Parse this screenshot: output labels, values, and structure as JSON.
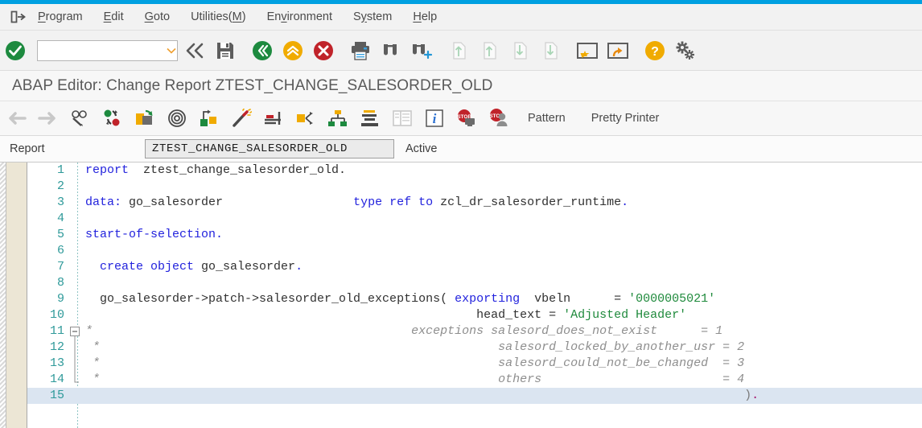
{
  "window": {
    "accent_color": "#00a0e1",
    "page_title": "ABAP Editor: Change Report ZTEST_CHANGE_SALESORDER_OLD"
  },
  "menubar": {
    "exit_icon": "exit-arrow-icon",
    "items": [
      {
        "label": "Program",
        "accel": "P"
      },
      {
        "label": "Edit",
        "accel": "E"
      },
      {
        "label": "Goto",
        "accel": "G"
      },
      {
        "label": "Utilities(M)",
        "accel": "M"
      },
      {
        "label": "Environment",
        "accel": "v"
      },
      {
        "label": "System",
        "accel": "y"
      },
      {
        "label": "Help",
        "accel": "H"
      }
    ]
  },
  "toolbar": {
    "enter_icon": "green-check-enter-icon",
    "command_field": {
      "value": "",
      "placeholder": ""
    },
    "dropdown_icon": "chevron-down-icon",
    "items": [
      {
        "name": "back-double-chevron-icon",
        "enabled": true
      },
      {
        "name": "save-icon",
        "enabled": true
      },
      {
        "name": "back-green-icon",
        "enabled": true
      },
      {
        "name": "exit-yellow-icon",
        "enabled": true
      },
      {
        "name": "cancel-red-icon",
        "enabled": true
      },
      {
        "name": "print-icon",
        "enabled": true
      },
      {
        "name": "find-icon",
        "enabled": true
      },
      {
        "name": "find-next-icon",
        "enabled": true
      },
      {
        "name": "first-page-icon",
        "enabled": false
      },
      {
        "name": "previous-page-icon",
        "enabled": false
      },
      {
        "name": "next-page-icon",
        "enabled": false
      },
      {
        "name": "last-page-icon",
        "enabled": false
      },
      {
        "name": "create-session-icon",
        "enabled": true
      },
      {
        "name": "create-shortcut-icon",
        "enabled": true
      },
      {
        "name": "help-icon",
        "enabled": true
      },
      {
        "name": "customize-layout-icon",
        "enabled": true
      }
    ]
  },
  "toolbar2": {
    "items": [
      {
        "name": "back-arrow-icon",
        "enabled": false
      },
      {
        "name": "forward-arrow-icon",
        "enabled": false
      },
      {
        "name": "display-change-icon",
        "enabled": true
      },
      {
        "name": "check-activate-icon",
        "enabled": true
      },
      {
        "name": "activate-icon",
        "enabled": true
      },
      {
        "name": "where-used-icon",
        "enabled": true
      },
      {
        "name": "insert-statement-icon",
        "enabled": true
      },
      {
        "name": "pretty-format-icon",
        "enabled": true
      },
      {
        "name": "signature-icon",
        "enabled": true
      },
      {
        "name": "navigate-icon",
        "enabled": true
      },
      {
        "name": "object-list-icon",
        "enabled": true
      },
      {
        "name": "outline-icon",
        "enabled": true
      },
      {
        "name": "split-screen-icon",
        "enabled": false
      },
      {
        "name": "info-icon",
        "enabled": true
      },
      {
        "name": "breakpoint-icon",
        "enabled": true
      },
      {
        "name": "user-breakpoint-icon",
        "enabled": true
      }
    ],
    "pattern_label": "Pattern",
    "pretty_printer_label": "Pretty Printer"
  },
  "report_bar": {
    "label": "Report",
    "name_value": "ZTEST_CHANGE_SALESORDER_OLD",
    "status": "Active"
  },
  "editor": {
    "selected_line": 15,
    "fold_start_line": 11,
    "fold_end_line": 14,
    "fold_icon": "collapse-minus-icon",
    "lines": [
      {
        "no": "1",
        "segments": [
          {
            "text": "report",
            "type": "keyword"
          },
          {
            "text": "  ztest_change_salesorder_old.",
            "type": "identifier"
          }
        ]
      },
      {
        "no": "2",
        "segments": []
      },
      {
        "no": "3",
        "segments": [
          {
            "text": "data:",
            "type": "keyword"
          },
          {
            "text": " go_salesorder",
            "type": "identifier"
          },
          {
            "text": "                  ",
            "type": "identifier"
          },
          {
            "text": "type ref to",
            "type": "keyword"
          },
          {
            "text": " zcl_dr_salesorder_runtime",
            "type": "identifier"
          },
          {
            "text": ".",
            "type": "keyword"
          }
        ]
      },
      {
        "no": "4",
        "segments": []
      },
      {
        "no": "5",
        "segments": [
          {
            "text": "start-of-selection",
            "type": "keyword"
          },
          {
            "text": ".",
            "type": "keyword"
          }
        ]
      },
      {
        "no": "6",
        "segments": []
      },
      {
        "no": "7",
        "segments": [
          {
            "text": "  create object",
            "type": "keyword"
          },
          {
            "text": " go_salesorder",
            "type": "identifier"
          },
          {
            "text": ".",
            "type": "keyword"
          }
        ]
      },
      {
        "no": "8",
        "segments": []
      },
      {
        "no": "9",
        "segments": [
          {
            "text": "  go_salesorder->patch->salesorder_old_exceptions(",
            "type": "identifier"
          },
          {
            "text": " exporting",
            "type": "keyword"
          },
          {
            "text": "  vbeln      = ",
            "type": "identifier"
          },
          {
            "text": "'0000005021'",
            "type": "string"
          }
        ]
      },
      {
        "no": "10",
        "segments": [
          {
            "text": "                                                      head_text = ",
            "type": "identifier"
          },
          {
            "text": "'Adjusted Header'",
            "type": "string"
          }
        ]
      },
      {
        "no": "11",
        "fold": "start",
        "segments": [
          {
            "text": "*",
            "type": "comment"
          },
          {
            "text": "                                            exceptions salesord_does_not_exist      = 1",
            "type": "comment"
          }
        ]
      },
      {
        "no": "12",
        "fold": "mid",
        "segments": [
          {
            "text": " *",
            "type": "comment"
          },
          {
            "text": "                                                       salesord_locked_by_another_usr = 2",
            "type": "comment"
          }
        ]
      },
      {
        "no": "13",
        "fold": "mid",
        "segments": [
          {
            "text": " *",
            "type": "comment"
          },
          {
            "text": "                                                       salesord_could_not_be_changed  = 3",
            "type": "comment"
          }
        ]
      },
      {
        "no": "14",
        "fold": "end",
        "segments": [
          {
            "text": " *",
            "type": "comment"
          },
          {
            "text": "                                                       others                         = 4",
            "type": "comment"
          }
        ]
      },
      {
        "no": "15",
        "selected": true,
        "segments": [
          {
            "text": "                                                                                           ",
            "type": "identifier"
          },
          {
            "text": ")",
            "type": "punct"
          },
          {
            "text": ".",
            "type": "magenta"
          }
        ]
      }
    ]
  },
  "colors": {
    "accent": "#00a0e1",
    "keyword": "#2222dd",
    "identifier": "#303030",
    "string": "#1f8a3c",
    "comment": "#8e8e8e",
    "line_number": "#2f9a9a",
    "selection": "#dbe5f1",
    "gutter": "#ece6d5",
    "toolbar_bg": "#f2f2f2"
  }
}
